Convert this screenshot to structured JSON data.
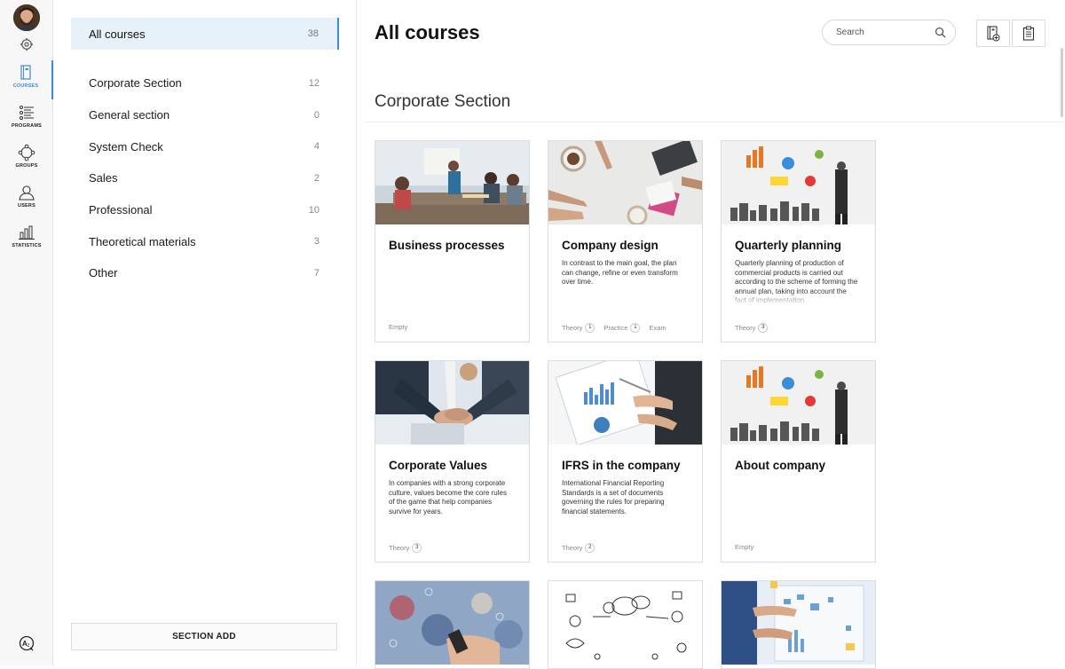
{
  "rail": {
    "items": [
      {
        "label": "COURSES",
        "icon": "book-icon",
        "active": true
      },
      {
        "label": "PROGRAMS",
        "icon": "list-icon",
        "active": false
      },
      {
        "label": "GROUPS",
        "icon": "groups-icon",
        "active": false
      },
      {
        "label": "USERS",
        "icon": "user-icon",
        "active": false
      },
      {
        "label": "STATISTICS",
        "icon": "bar-chart-icon",
        "active": false
      }
    ]
  },
  "sections": {
    "all": {
      "name": "All courses",
      "count": "38"
    },
    "items": [
      {
        "name": "Corporate Section",
        "count": "12"
      },
      {
        "name": "General section",
        "count": "0"
      },
      {
        "name": "System Check",
        "count": "4"
      },
      {
        "name": "Sales",
        "count": "2"
      },
      {
        "name": "Professional",
        "count": "10"
      },
      {
        "name": "Theoretical materials",
        "count": "3"
      },
      {
        "name": "Other",
        "count": "7"
      }
    ],
    "add_label": "SECTION ADD"
  },
  "header": {
    "title": "All courses",
    "search_placeholder": "Search"
  },
  "group": {
    "title": "Corporate Section"
  },
  "cards": [
    {
      "title": "Business processes",
      "description": "",
      "meta": [
        {
          "label": "Empty",
          "count": ""
        }
      ]
    },
    {
      "title": "Company design",
      "description": "In contrast to the main goal, the plan can change, refine or even transform over time.",
      "meta": [
        {
          "label": "Theory",
          "count": "1"
        },
        {
          "label": "Practice",
          "count": "1"
        },
        {
          "label": "Exam",
          "count": ""
        }
      ]
    },
    {
      "title": "Quarterly planning",
      "description": "Quarterly planning of production of commercial products is carried out according to the scheme of forming the annual plan, taking into account the fact of implementation",
      "meta": [
        {
          "label": "Theory",
          "count": "3"
        }
      ]
    },
    {
      "title": "Corporate Values",
      "description": "In companies with a strong corporate culture, values become the core rules of the game that help companies survive for years.",
      "meta": [
        {
          "label": "Theory",
          "count": "3"
        }
      ]
    },
    {
      "title": "IFRS in the company",
      "description": "International Financial Reporting Standards is a set of documents governing the rules for preparing financial statements.",
      "meta": [
        {
          "label": "Theory",
          "count": "2"
        }
      ]
    },
    {
      "title": "About company",
      "description": "",
      "meta": [
        {
          "label": "Empty",
          "count": ""
        }
      ]
    }
  ],
  "colors": {
    "accent": "#3a8dd8",
    "active_bg": "#e7f1f9"
  }
}
